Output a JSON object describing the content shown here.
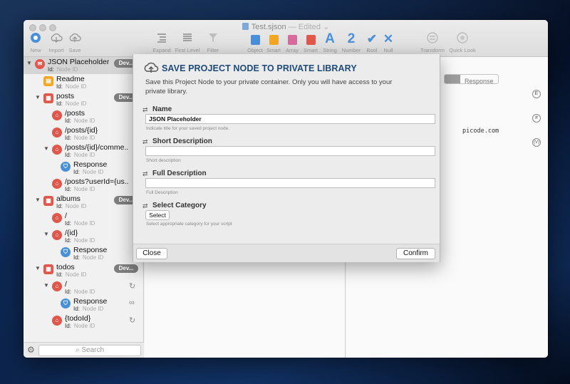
{
  "window": {
    "title": "Test.sjson",
    "status": "— Edited ⌄"
  },
  "toolbar": {
    "left": [
      {
        "label": "New",
        "icon": "new-icon"
      },
      {
        "label": "Import",
        "icon": "import-icon"
      },
      {
        "label": "Save",
        "icon": "save-icon"
      }
    ],
    "middle": [
      {
        "label": "Expand",
        "icon": "expand-icon"
      },
      {
        "label": "First Level",
        "icon": "first-level-icon"
      },
      {
        "label": "Filter",
        "icon": "filter-icon"
      }
    ],
    "types": [
      {
        "label": "Object",
        "icon": "object-cube-icon",
        "color": "#4a90d9"
      },
      {
        "label": "Smart",
        "icon": "smart-cube-icon",
        "color": "#f5a623"
      },
      {
        "label": "Array",
        "icon": "array-cube-icon",
        "color": "#d76b9e"
      },
      {
        "label": "Smart",
        "icon": "smart-array-cube-icon",
        "color": "#e2574c"
      },
      {
        "label": "String",
        "icon": "string-icon",
        "glyph": "A"
      },
      {
        "label": "Number",
        "icon": "number-icon",
        "glyph": "2"
      },
      {
        "label": "Bool",
        "icon": "bool-icon",
        "glyph": "✔"
      },
      {
        "label": "Null",
        "icon": "null-icon",
        "glyph": "✕"
      }
    ],
    "right": [
      {
        "label": "Transform",
        "icon": "transform-icon"
      },
      {
        "label": "Quick Look",
        "icon": "quick-look-icon"
      }
    ]
  },
  "tree": {
    "id_label": "Id:",
    "id_placeholder": "Node ID",
    "badge": "Dev...",
    "rows": [
      {
        "name": "JSON Placeholder",
        "badge": true
      },
      {
        "name": "Readme"
      },
      {
        "name": "posts",
        "badge": true
      },
      {
        "name": "/posts"
      },
      {
        "name": "/posts/{id}"
      },
      {
        "name": "/posts/{id}/comme..."
      },
      {
        "name": "Response"
      },
      {
        "name": "/posts?userId={us..."
      },
      {
        "name": "albums",
        "badge": true
      },
      {
        "name": "/"
      },
      {
        "name": "/{id}"
      },
      {
        "name": "Response"
      },
      {
        "name": "todos",
        "badge": true
      },
      {
        "name": "/"
      },
      {
        "name": "Response"
      },
      {
        "name": "{todoId}"
      }
    ]
  },
  "sidebar_footer": {
    "search_placeholder": "Search"
  },
  "right_pane": {
    "segment_response": "Response",
    "url_fragment": "picode.com",
    "badges": [
      "E",
      "#",
      "(V)"
    ]
  },
  "dialog": {
    "title": "SAVE PROJECT NODE TO PRIVATE LIBRARY",
    "description": "Save this Project Node to your private container. Only you will have access to your private library.",
    "fields": {
      "name": {
        "label": "Name",
        "value": "JSON Placeholder",
        "hint": "Indicate title for your saved project node."
      },
      "short_description": {
        "label": "Short Description",
        "value": "",
        "hint": "Short description"
      },
      "full_description": {
        "label": "Full Description",
        "value": "",
        "hint": "Full Description"
      },
      "category": {
        "label": "Select Category",
        "button": "Select",
        "hint": "Select appropriate category for your script"
      }
    },
    "close_label": "Close",
    "confirm_label": "Confirm"
  }
}
